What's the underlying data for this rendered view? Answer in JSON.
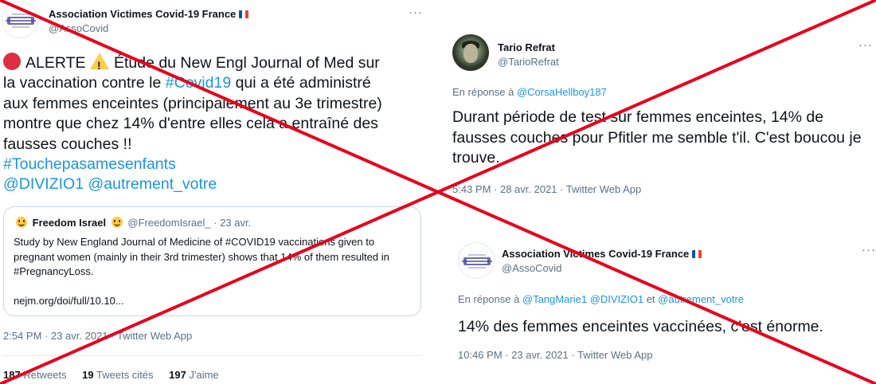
{
  "colors": {
    "cross_red": "#e8001c",
    "link_blue": "#1b95e0",
    "muted_gray": "#5b7083"
  },
  "tweet1": {
    "avatar_icon": "association-logo-icon",
    "name": "Association Victimes Covid-19 France",
    "handle": "@AssoCovid",
    "more_label": "···",
    "body": {
      "line1": "ALERTE",
      "line1_rest": "Étude du New Engl Journal of Med sur",
      "line2_pre": "la vaccination contre le ",
      "line2_tag": "#Covid19",
      "line2_post": " qui a été administré",
      "line3": "aux femmes enceintes (principalement au 3e trimestre)",
      "line4": "montre que chez 14% d'entre elles cela a entraîné des",
      "line5": "fausses couches !!",
      "hashtag": "#Touchepasamesenfants",
      "mention1": "@DIVIZIO1",
      "mention2": "@autrement_votre"
    },
    "quote": {
      "name": "Freedom Israel",
      "handle": "@FreedomIsrael_",
      "date": "· 23 avr.",
      "text": "Study by New England Journal of Medicine of #COVID19 vaccinations given to pregnant women (mainly in their 3rd trimester) shows that 14% of them resulted in #PregnancyLoss.",
      "link": "nejm.org/doi/full/10.10..."
    },
    "timestamp": "2:54 PM · 23 avr. 2021 · Twitter Web App",
    "stats": {
      "retweets_count": "187",
      "retweets_label": "Retweets",
      "quotes_count": "19",
      "quotes_label": "Tweets cités",
      "likes_count": "197",
      "likes_label": "J'aime"
    }
  },
  "tweet2": {
    "avatar_icon": "profile-photo",
    "name": "Tario Refrat",
    "handle": "@TarioRefrat",
    "more_label": "···",
    "reply_prefix": "En réponse à ",
    "reply_to": "@CorsaHellboy187",
    "body": "Durant période de test sur femmes enceintes, 14% de fausses couches pour Pfitler me semble t'il. C'est boucou je trouve.",
    "timestamp": "5:43 PM · 28 avr. 2021 · Twitter Web App"
  },
  "tweet3": {
    "avatar_icon": "association-logo-icon",
    "name": "Association Victimes Covid-19 France",
    "handle": "@AssoCovid",
    "more_label": "···",
    "reply_prefix": "En réponse à ",
    "reply_to1": "@TangMarie1",
    "reply_to2": "@DIVIZIO1",
    "reply_and": " et ",
    "reply_to3": "@autrement_votre",
    "body": "14% des femmes enceintes vaccinées, c'est énorme.",
    "timestamp": "10:46 PM · 23 avr. 2021 · Twitter Web App"
  }
}
